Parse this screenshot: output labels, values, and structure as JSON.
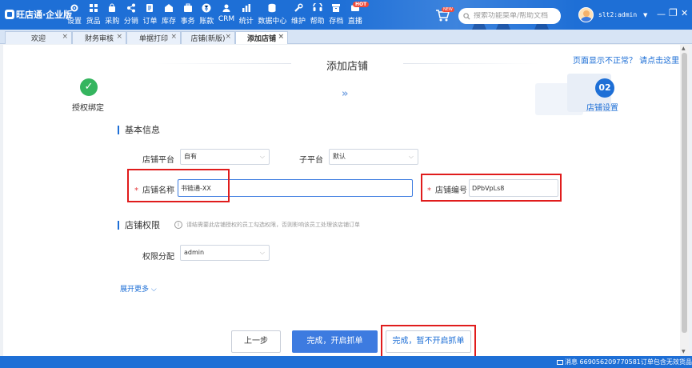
{
  "app": {
    "brand": "旺店通·企业版",
    "menu": [
      "设置",
      "货品",
      "采购",
      "分销",
      "订单",
      "库存",
      "事务",
      "账款",
      "CRM",
      "统计",
      "数据中心",
      "维护",
      "帮助",
      "存档",
      "直播"
    ],
    "hot_badge": "HOT",
    "new_badge": "NEW",
    "search_placeholder": "搜索功能菜单/帮助文档",
    "username": "slt2:admin",
    "colors": {
      "primary": "#1e6fd6",
      "success": "#35b55f",
      "highlight": "#e01c1c"
    }
  },
  "tabs": [
    {
      "label": "欢迎",
      "active": false
    },
    {
      "label": "财务审核",
      "active": false
    },
    {
      "label": "单据打印",
      "active": false
    },
    {
      "label": "店铺(新版)",
      "active": false
    },
    {
      "label": "添加店铺",
      "active": true
    }
  ],
  "page": {
    "title": "添加店铺",
    "help_link": "页面显示不正常？ 请点击这里",
    "steps": [
      {
        "number": "✓",
        "label": "授权绑定",
        "state": "done"
      },
      {
        "number": "02",
        "label": "店铺设置",
        "state": "current"
      }
    ],
    "step_arrow": "»"
  },
  "form": {
    "basic_title": "基本信息",
    "platform_label": "店铺平台",
    "platform_value": "自有",
    "subplatform_label": "子平台",
    "subplatform_value": "默认",
    "shop_name_label": "店铺名称",
    "shop_name_value": "书链通-XX",
    "shop_code_label": "店铺编号",
    "shop_code_value": "DPbVpLs8",
    "perm_title": "店铺权限",
    "perm_hint": "请结需要此店铺授权的员工勾选权限，否则影响该员工处理该店铺订单",
    "perm_assign_label": "权限分配",
    "perm_assign_value": "admin",
    "expand_more": "展开更多"
  },
  "buttons": {
    "prev": "上一步",
    "finish_start": "完成，开启抓单",
    "finish_no_start": "完成，暂不开启抓单"
  },
  "status": {
    "message": "消息 669056209770581订单包含无效货品"
  }
}
